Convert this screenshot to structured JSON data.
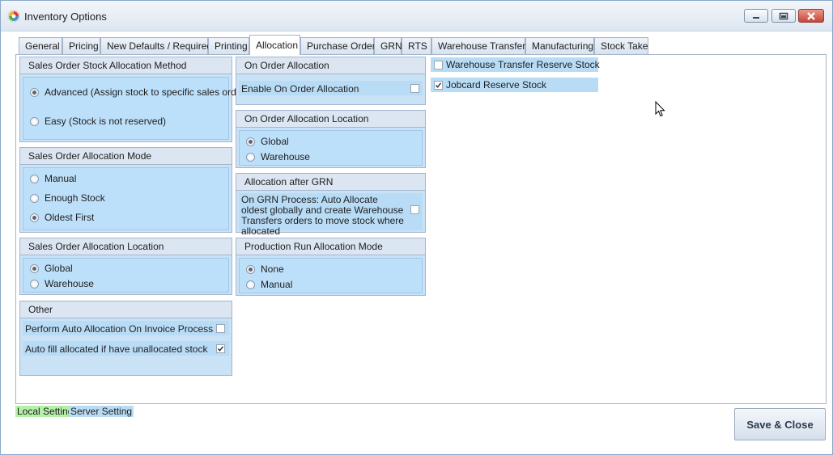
{
  "window": {
    "title": "Inventory Options"
  },
  "tabs": [
    "General",
    "Pricing",
    "New Defaults / Required",
    "Printing",
    "Allocation",
    "Purchase Order",
    "GRN",
    "RTS",
    "Warehouse Transfer",
    "Manufacturing",
    "Stock Take"
  ],
  "active_tab": "Allocation",
  "groups": {
    "stock_method": {
      "title": "Sales Order Stock Allocation Method",
      "options": [
        "Advanced (Assign stock to specific sales order)",
        "Easy (Stock is not reserved)"
      ],
      "selected": "Advanced (Assign stock to specific sales order)"
    },
    "alloc_mode": {
      "title": "Sales Order Allocation Mode",
      "options": [
        "Manual",
        "Enough Stock",
        "Oldest First"
      ],
      "selected": "Oldest First"
    },
    "alloc_location": {
      "title": "Sales Order Allocation Location",
      "options": [
        "Global",
        "Warehouse"
      ],
      "selected": "Global"
    },
    "other": {
      "title": "Other",
      "items": [
        {
          "label": "Perform Auto Allocation On Invoice Process",
          "checked": false
        },
        {
          "label": "Auto fill allocated if have unallocated stock",
          "checked": true
        }
      ]
    },
    "on_order": {
      "title": "On Order Allocation",
      "items": [
        {
          "label": "Enable On Order Allocation",
          "checked": false
        }
      ]
    },
    "on_order_location": {
      "title": "On Order Allocation Location",
      "options": [
        "Global",
        "Warehouse"
      ],
      "selected": "Global"
    },
    "after_grn": {
      "title": "Allocation after GRN",
      "items": [
        {
          "label": "On GRN Process: Auto Allocate oldest globally and create Warehouse Transfers orders to move stock where allocated",
          "checked": false
        }
      ]
    },
    "production": {
      "title": "Production Run Allocation Mode",
      "options": [
        "None",
        "Manual"
      ],
      "selected": "None"
    }
  },
  "right_checks": [
    {
      "label": "Warehouse Transfer Reserve Stock",
      "checked": false
    },
    {
      "label": "Jobcard Reserve Stock",
      "checked": true
    }
  ],
  "legend": {
    "local": "Local Setting",
    "server": "Server Setting",
    "local_color": "#b5f0a8",
    "server_color": "#b9dcf6"
  },
  "buttons": {
    "save_close": "Save & Close"
  },
  "icons": {
    "app": "app-logo-icon",
    "minimize": "minimize-icon",
    "restore": "restore-icon",
    "close": "close-icon",
    "cursor": "mouse-pointer-icon"
  }
}
